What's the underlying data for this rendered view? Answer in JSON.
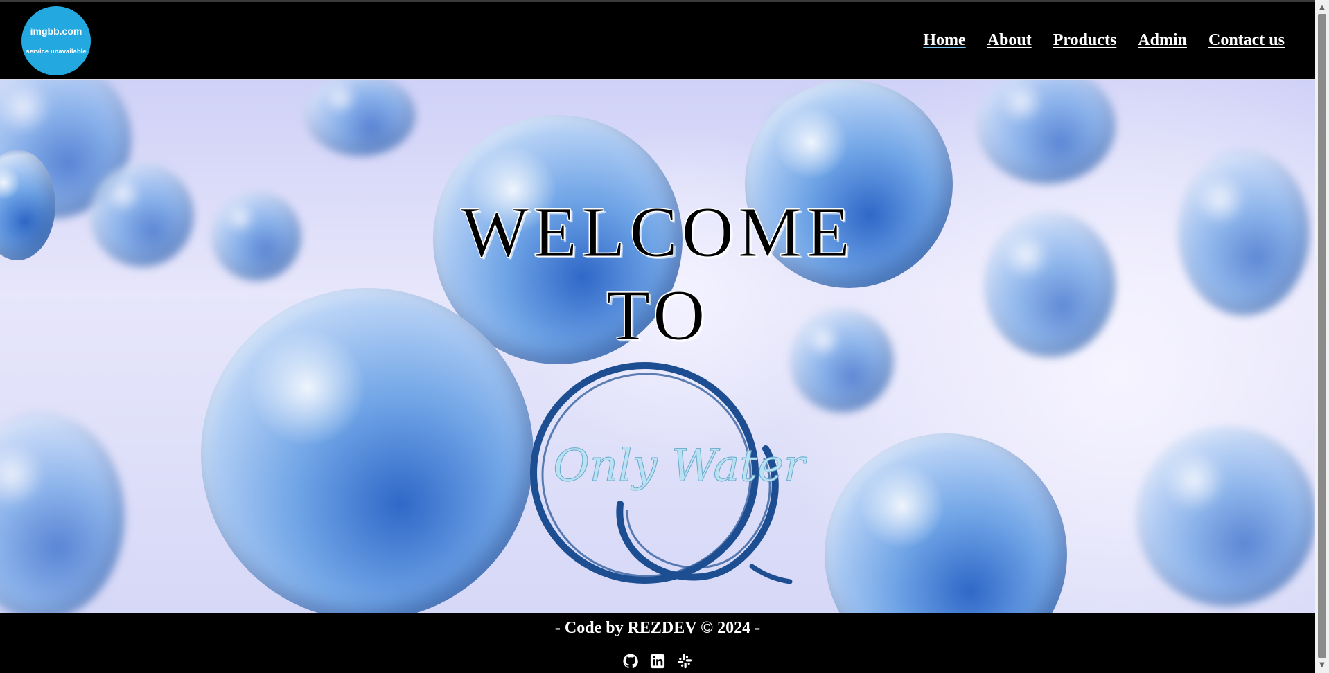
{
  "logo": {
    "line1": "imgbb.com",
    "line2": "service unavailable"
  },
  "nav": {
    "items": [
      {
        "label": "Home",
        "active": true
      },
      {
        "label": "About"
      },
      {
        "label": "Products"
      },
      {
        "label": "Admin"
      },
      {
        "label": "Contact us"
      }
    ]
  },
  "hero": {
    "line1": "WELCOME",
    "line2": "TO",
    "brand_text": "Only Water"
  },
  "footer": {
    "credit": "- Code by REZDEV © 2024 -",
    "socials": [
      "github-icon",
      "linkedin-icon",
      "slack-icon"
    ]
  },
  "colors": {
    "logo_bg": "#23a8e0",
    "brand_blue": "#1d4e91",
    "active_underline": "#7fc6ee"
  }
}
